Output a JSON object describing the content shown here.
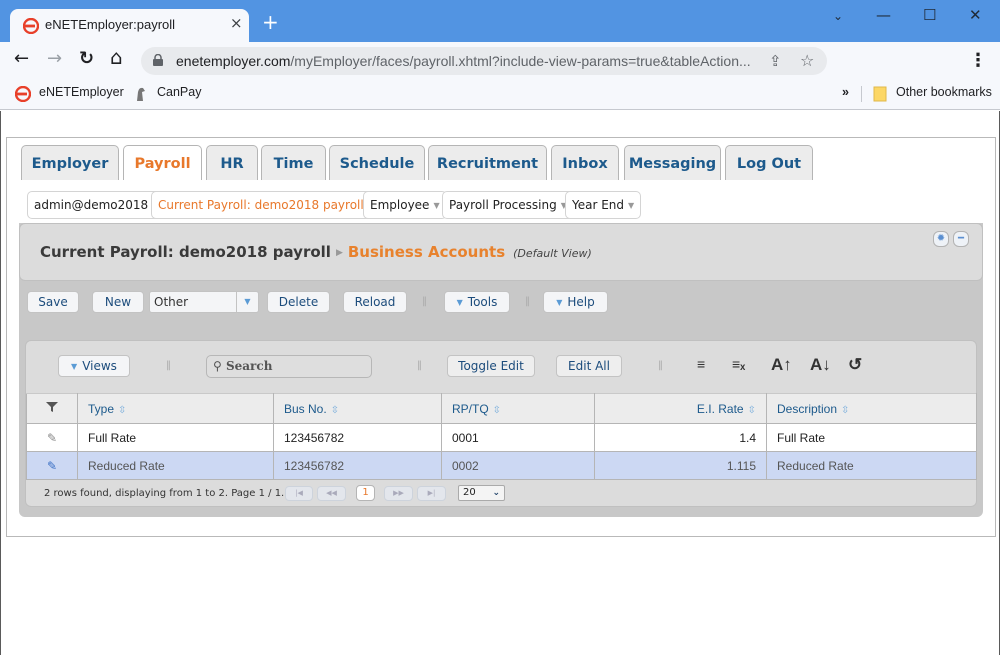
{
  "browser": {
    "tab_title": "eNETEmployer:payroll",
    "url_host": "enetemployer.com",
    "url_path": "/myEmployer/faces/payroll.xhtml?include-view-params=true&tableAction...",
    "bookmarks": [
      "eNETEmployer",
      "CanPay"
    ],
    "other_bookmarks": "Other bookmarks",
    "icons": {
      "close": "×",
      "new_tab": "+",
      "back": "←",
      "forward": "→",
      "reload": "↻",
      "home": "⌂",
      "share": "⇪",
      "star": "☆",
      "menu": "⋮",
      "overflow": "»",
      "minimize": "—",
      "maximize": "☐",
      "window_close": "✕",
      "tab_search": "⌄"
    }
  },
  "main_tabs": [
    "Employer",
    "Payroll",
    "HR",
    "Time",
    "Schedule",
    "Recruitment",
    "Inbox",
    "Messaging",
    "Log Out"
  ],
  "active_tab": "Payroll",
  "subnav": [
    "admin@demo2018",
    "Current Payroll: demo2018 payroll",
    "Employee",
    "Payroll Processing",
    "Year End"
  ],
  "panel": {
    "title": "Current Payroll: demo2018 payroll",
    "section": "Business Accounts",
    "view": "(Default View)"
  },
  "actions": {
    "save": "Save",
    "new": "New",
    "other_select": "Other",
    "delete": "Delete",
    "reload": "Reload",
    "tools": "Tools",
    "help": "Help"
  },
  "grid": {
    "views": "Views",
    "search_placeholder": "Search",
    "toggle_edit": "Toggle Edit",
    "edit_all": "Edit All",
    "columns": [
      "Type",
      "Bus No.",
      "RP/TQ",
      "E.I. Rate",
      "Description"
    ],
    "rows": [
      {
        "type": "Full Rate",
        "bus_no": "123456782",
        "rp_tq": "0001",
        "ei_rate": "1.4",
        "description": "Full Rate"
      },
      {
        "type": "Reduced Rate",
        "bus_no": "123456782",
        "rp_tq": "0002",
        "ei_rate": "1.115",
        "description": "Reduced Rate"
      }
    ],
    "selected_row": 1,
    "footer_text": "2 rows found, displaying from 1 to 2. Page 1 / 1.",
    "current_page": "1",
    "page_size": "20"
  },
  "colors": {
    "brand_orange": "#e8782b",
    "link_blue": "#1d5a8c",
    "selected_row": "#ccd8f3",
    "chrome_blue": "#5294e2"
  }
}
